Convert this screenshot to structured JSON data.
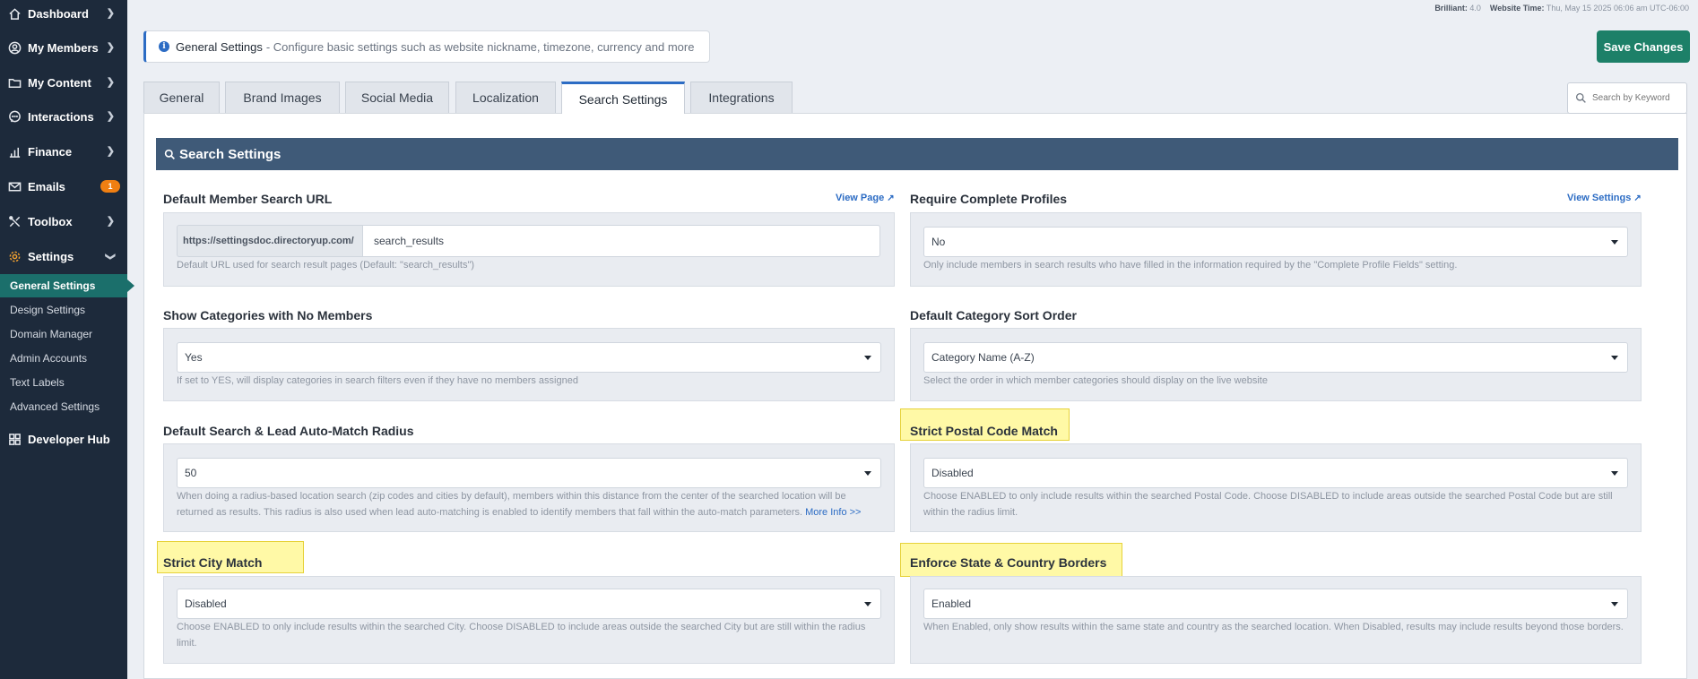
{
  "sidebar": {
    "items": [
      {
        "label": "Dashboard",
        "icon": "home-icon"
      },
      {
        "label": "My Members",
        "icon": "user-icon"
      },
      {
        "label": "My Content",
        "icon": "folder-icon"
      },
      {
        "label": "Interactions",
        "icon": "chat-icon"
      },
      {
        "label": "Finance",
        "icon": "bar-chart-icon"
      },
      {
        "label": "Emails",
        "icon": "mail-icon",
        "badge": "1"
      },
      {
        "label": "Toolbox",
        "icon": "tools-icon"
      },
      {
        "label": "Settings",
        "icon": "gear-icon"
      }
    ],
    "settings_sub": [
      "General Settings",
      "Design Settings",
      "Domain Manager",
      "Admin Accounts",
      "Text Labels",
      "Advanced Settings"
    ],
    "developer_hub": "Developer Hub"
  },
  "topbar": {
    "version_label": "Brilliant:",
    "version": "4.0",
    "time_label": "Website Time:",
    "time": "Thu, May 15 2025 06:06 am UTC-06:00"
  },
  "notice": {
    "title": "General Settings",
    "desc": "- Configure basic settings such as website nickname, timezone, currency and more"
  },
  "save_label": "Save Changes",
  "tabs": [
    "General",
    "Brand Images",
    "Social Media",
    "Localization",
    "Search Settings",
    "Integrations"
  ],
  "active_tab": "Search Settings",
  "search_placeholder": "Search by Keyword",
  "section_title": "Search Settings",
  "fields": {
    "member_url": {
      "label": "Default Member Search URL",
      "link": "View Page",
      "prefix": "https://settingsdoc.directoryup.com/",
      "value": "search_results",
      "help": "Default URL used for search result pages (Default: \"search_results\")"
    },
    "complete_profiles": {
      "label": "Require Complete Profiles",
      "link": "View Settings",
      "value": "No",
      "help": "Only include members in search results who have filled in the information required by the \"Complete Profile Fields\" setting."
    },
    "show_categories": {
      "label": "Show Categories with No Members",
      "value": "Yes",
      "help": "If set to YES, will display categories in search filters even if they have no members assigned"
    },
    "category_sort": {
      "label": "Default Category Sort Order",
      "value": "Category Name (A-Z)",
      "help": "Select the order in which member categories should display on the live website"
    },
    "radius": {
      "label": "Default Search & Lead Auto-Match Radius",
      "value": "50",
      "help": "When doing a radius-based location search (zip codes and cities by default), members within this distance from the center of the searched location will be returned as results. This radius is also used when lead auto-matching is enabled to identify members that fall within the auto-match parameters.",
      "more": "More Info >>"
    },
    "postal": {
      "label": "Strict Postal Code Match",
      "value": "Disabled",
      "help": "Choose ENABLED to only include results within the searched Postal Code. Choose DISABLED to include areas outside the searched Postal Code but are still within the radius limit."
    },
    "city": {
      "label": "Strict City Match",
      "value": "Disabled",
      "help": "Choose ENABLED to only include results within the searched City. Choose DISABLED to include areas outside the searched City but are still within the radius limit."
    },
    "borders": {
      "label": "Enforce State & Country Borders",
      "value": "Enabled",
      "help": "When Enabled, only show results within the same state and country as the searched location. When Disabled, results may include results beyond those borders."
    }
  },
  "colors": {
    "sidebar_bg": "#1d2a3b",
    "accent": "#1d8068",
    "section_head": "#3f5a78",
    "highlight": "#fff9a6",
    "link": "#2c6cc4",
    "badge": "#f07f12"
  }
}
